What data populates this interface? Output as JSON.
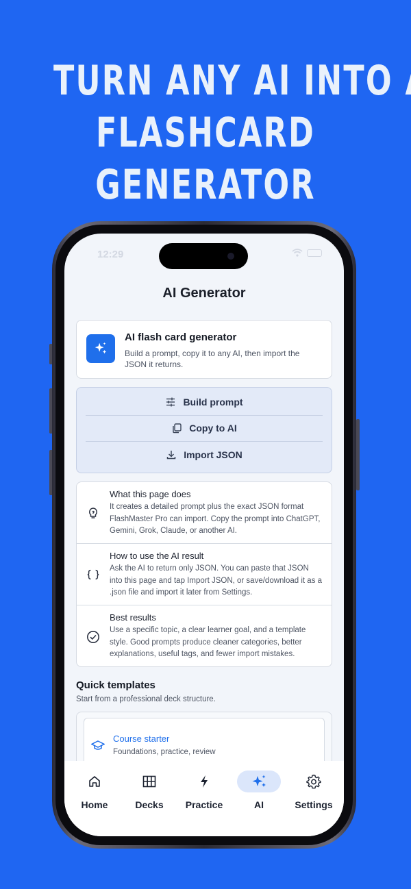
{
  "headline": {
    "line1": "TURN ANY AI INTO A",
    "line2": "FLASHCARD",
    "line3": "GENERATOR"
  },
  "status_bar": {
    "time": "12:29"
  },
  "page": {
    "title": "AI Generator"
  },
  "hero": {
    "title": "AI flash card generator",
    "description": "Build a prompt, copy it to any AI, then import the JSON it returns.",
    "icon": "sparkles-icon"
  },
  "actions": [
    {
      "label": "Build prompt",
      "icon": "tune-icon"
    },
    {
      "label": "Copy to AI",
      "icon": "copy-icon"
    },
    {
      "label": "Import JSON",
      "icon": "download-icon"
    }
  ],
  "info": [
    {
      "title": "What this page does",
      "text": "It creates a detailed prompt plus the exact JSON format FlashMaster Pro can import. Copy the prompt into ChatGPT, Gemini, Grok, Claude, or another AI.",
      "icon": "lightbulb-icon"
    },
    {
      "title": "How to use the AI result",
      "text": "Ask the AI to return only JSON. You can paste that JSON into this page and tap Import JSON, or save/download it as a .json file and import it later from Settings.",
      "icon": "braces-icon"
    },
    {
      "title": "Best results",
      "text": "Use a specific topic, a clear learner goal, and a template style. Good prompts produce cleaner categories, better explanations, useful tags, and fewer import mistakes.",
      "icon": "check-circle-icon"
    }
  ],
  "templates_section": {
    "title": "Quick templates",
    "subtitle": "Start from a professional deck structure.",
    "items": [
      {
        "name": "Course starter",
        "description": "Foundations, practice, review",
        "icon": "graduation-cap-icon"
      }
    ]
  },
  "tabbar": {
    "active": "AI",
    "tabs": [
      {
        "label": "Home",
        "icon": "home-icon"
      },
      {
        "label": "Decks",
        "icon": "grid-icon"
      },
      {
        "label": "Practice",
        "icon": "bolt-icon"
      },
      {
        "label": "AI",
        "icon": "sparkles-icon"
      },
      {
        "label": "Settings",
        "icon": "gear-icon"
      }
    ]
  },
  "colors": {
    "background": "#1F66F2",
    "accent": "#1F6FEB",
    "headline": "#E9F1FB",
    "screen": "#F2F5FA"
  }
}
